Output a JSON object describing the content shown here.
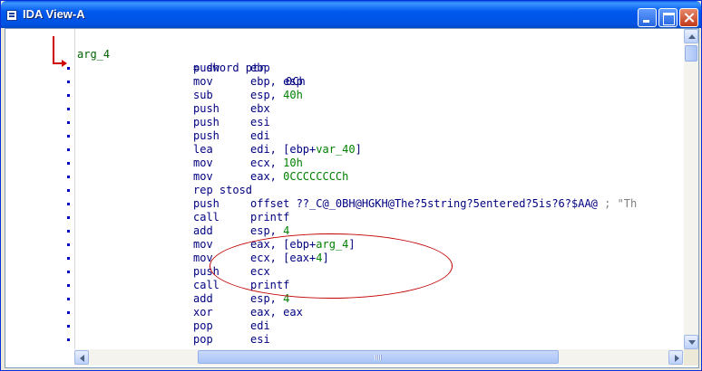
{
  "window": {
    "title": "IDA View-A",
    "buttons": [
      "minimize",
      "maximize",
      "close"
    ],
    "colors": {
      "titlebar": "#0058EE",
      "annotation": "#C00000",
      "code": "#000080",
      "highlight": "#008000"
    }
  },
  "code": {
    "header": {
      "label": "arg_4",
      "eq": "= dword ptr",
      "value": "0Ch"
    },
    "lines": [
      {
        "mnem": "push",
        "ops": "ebp"
      },
      {
        "mnem": "mov",
        "ops": "ebp, esp"
      },
      {
        "mnem": "sub",
        "ops": "esp, ",
        "ops_hl": "40h"
      },
      {
        "mnem": "push",
        "ops": "ebx"
      },
      {
        "mnem": "push",
        "ops": "esi"
      },
      {
        "mnem": "push",
        "ops": "edi"
      },
      {
        "mnem": "lea",
        "ops": "edi, [ebp+",
        "ops_hl": "var_40",
        "ops_tail": "]"
      },
      {
        "mnem": "mov",
        "ops": "ecx, ",
        "ops_hl": "10h"
      },
      {
        "mnem": "mov",
        "ops": "eax, ",
        "ops_hl": "0CCCCCCCCh"
      },
      {
        "mnem": "rep stosd",
        "ops": ""
      },
      {
        "mnem": "push",
        "ops": "offset ??_C@_0BH@HGKH@The?5string?5entered?5is?6?$AA@",
        "comment": " ; \"Th"
      },
      {
        "mnem": "call",
        "ops": "printf"
      },
      {
        "mnem": "add",
        "ops": "esp, ",
        "ops_hl": "4"
      },
      {
        "mnem": "mov",
        "ops": "eax, [ebp+",
        "ops_hl": "arg_4",
        "ops_tail": "]"
      },
      {
        "mnem": "mov",
        "ops": "ecx, [eax+",
        "ops_hl": "4",
        "ops_tail": "]"
      },
      {
        "mnem": "push",
        "ops": "ecx"
      },
      {
        "mnem": "call",
        "ops": "printf"
      },
      {
        "mnem": "add",
        "ops": "esp, ",
        "ops_hl": "4"
      },
      {
        "mnem": "xor",
        "ops": "eax, eax"
      },
      {
        "mnem": "pop",
        "ops": "edi"
      },
      {
        "mnem": "pop",
        "ops": "esi"
      }
    ]
  }
}
